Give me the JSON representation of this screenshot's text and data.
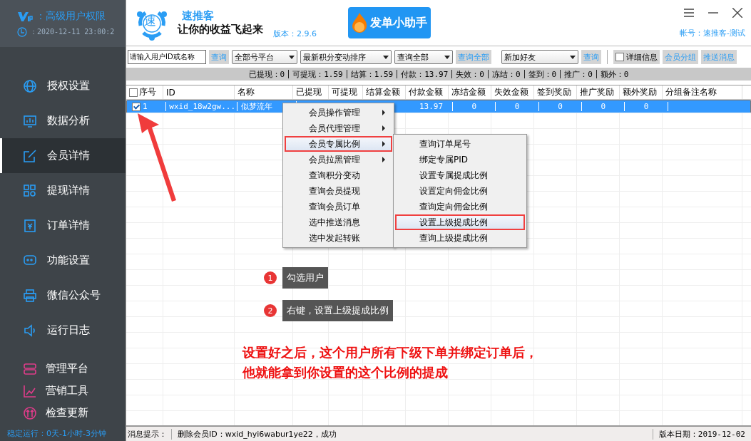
{
  "sidebar": {
    "vip_label": "：高级用户权限",
    "expiry": "：2020-12-11 23:00:2",
    "items": [
      {
        "label": "授权设置",
        "selected": false
      },
      {
        "label": "数据分析",
        "selected": false
      },
      {
        "label": "会员详情",
        "selected": true
      },
      {
        "label": "提现详情",
        "selected": false
      },
      {
        "label": "订单详情",
        "selected": false
      },
      {
        "label": "功能设置",
        "selected": false
      },
      {
        "label": "微信公众号",
        "selected": false
      },
      {
        "label": "运行日志",
        "selected": false
      }
    ],
    "tools": [
      {
        "label": "管理平台"
      },
      {
        "label": "营销工具"
      },
      {
        "label": "检查更新"
      }
    ],
    "uptime": "稳定运行：0天-1小时-3分钟"
  },
  "header": {
    "app_name": "速推客",
    "logo_char": "速",
    "slogan": "让你的收益飞起来",
    "version": "版本：2.9.6",
    "banner": "发单小助手",
    "account": "帐号：速推客-测试"
  },
  "toolbar": {
    "search_value": "请输入用户ID或名称",
    "search_button": "查询",
    "platform": "全部号平台",
    "sort": "最新积分变动排序",
    "filter": "查询全部",
    "query_all": "查询全部",
    "friend": "新加好友",
    "query": "查询",
    "detail": {
      "label": "详细信息",
      "checked": false
    },
    "group": "会员分组",
    "push": "推送消息"
  },
  "summary": [
    "已提现：0",
    "可提现：1.59",
    "结算：1.59",
    "付款：13.97",
    "失效：0",
    "冻结：0",
    "签到：0",
    "推广：0",
    "额外：0"
  ],
  "table": {
    "select_all_checked": false,
    "columns": [
      "序号",
      "ID",
      "名称",
      "已提现",
      "可提现",
      "结算金额",
      "付款金额",
      "冻结金额",
      "失效金额",
      "签到奖励",
      "推广奖励",
      "额外奖励",
      "分组备注名称"
    ],
    "rows": [
      {
        "selected": true,
        "checked": true,
        "cells": [
          "1",
          "wxid_18w2gw...",
          "似梦流年",
          null,
          null,
          null,
          "13.97",
          "0",
          "0",
          "0",
          "0",
          "0",
          ""
        ]
      }
    ]
  },
  "context_menu": [
    {
      "label": "会员操作管理",
      "submenu": true,
      "highlighted": false
    },
    {
      "label": "会员代理管理",
      "submenu": true,
      "highlighted": false
    },
    {
      "label": "会员专属比例",
      "submenu": true,
      "highlighted": true
    },
    {
      "label": "会员拉黑管理",
      "submenu": true,
      "highlighted": false
    },
    {
      "label": "查询积分变动",
      "submenu": false,
      "highlighted": false
    },
    {
      "label": "查询会员提现",
      "submenu": false,
      "highlighted": false
    },
    {
      "label": "查询会员订单",
      "submenu": false,
      "highlighted": false
    },
    {
      "label": "选中推送消息",
      "submenu": false,
      "highlighted": false
    },
    {
      "label": "选中发起转账",
      "submenu": false,
      "highlighted": false
    }
  ],
  "submenu": [
    {
      "label": "查询订单尾号",
      "highlighted": false
    },
    {
      "label": "绑定专属PID",
      "highlighted": false
    },
    {
      "label": "设置专属提成比例",
      "highlighted": false
    },
    {
      "label": "设置定向佣金比例",
      "highlighted": false
    },
    {
      "label": "查询定向佣金比例",
      "highlighted": false
    },
    {
      "label": "设置上级提成比例",
      "highlighted": true
    },
    {
      "label": "查询上级提成比例",
      "highlighted": false
    }
  ],
  "annotations": {
    "steps": [
      {
        "number": "1",
        "text": "勾选用户"
      },
      {
        "number": "2",
        "text": "右键，设置上级提成比例"
      }
    ],
    "note": [
      "设置好之后，这个用户所有下级下单并绑定订单后，",
      "他就能拿到你设置的这个比例的提成"
    ]
  },
  "status_bar": {
    "label": "消息提示：",
    "message": "删除会员ID：wxid_hyi6wabur1ye22，成功",
    "version_date": "版本日期：2019-12-02"
  }
}
